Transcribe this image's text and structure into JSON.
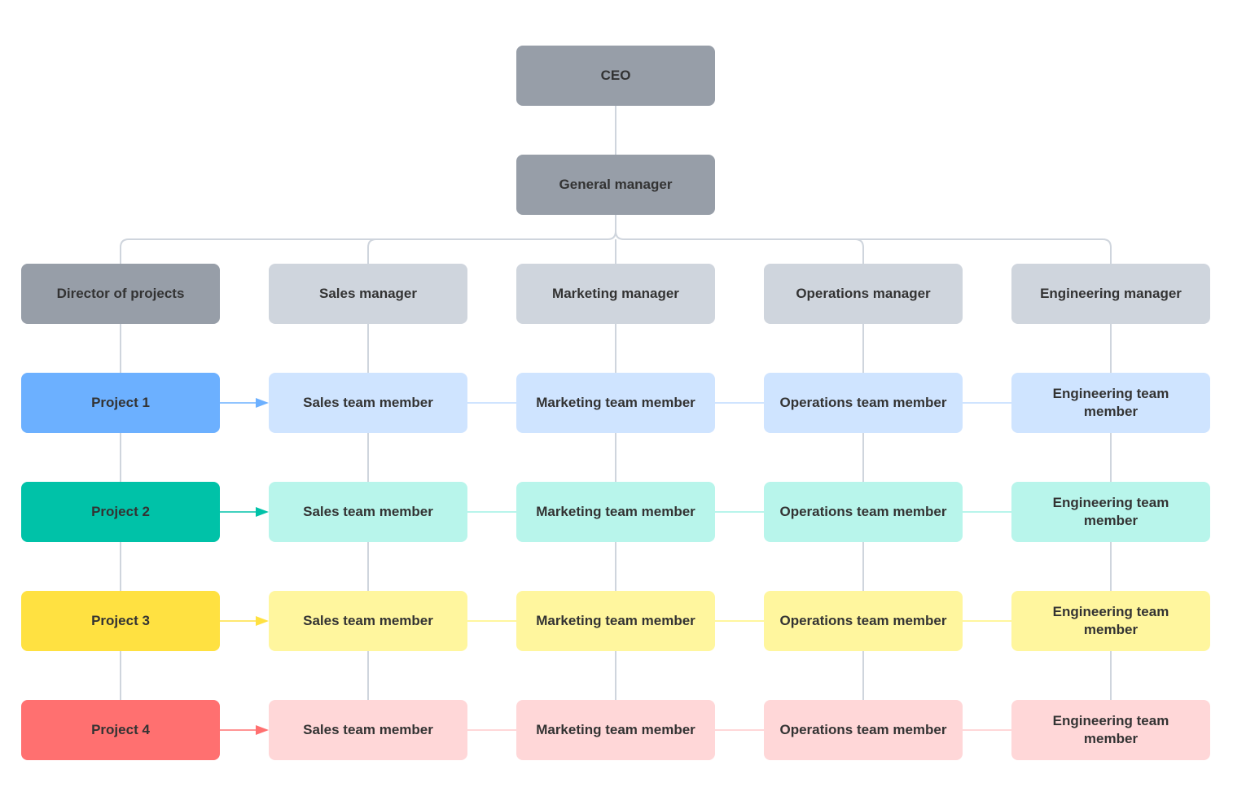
{
  "chart": {
    "ceo": {
      "label": "CEO",
      "color": "#979ea8"
    },
    "general_manager": {
      "label": "General manager",
      "color": "#979ea8"
    },
    "director": {
      "label": "Director of projects",
      "color": "#979ea8"
    },
    "managers": [
      {
        "label": "Sales manager",
        "color": "#cfd5dd"
      },
      {
        "label": "Marketing manager",
        "color": "#cfd5dd"
      },
      {
        "label": "Operations manager",
        "color": "#cfd5dd"
      },
      {
        "label": "Engineering manager",
        "color": "#cfd5dd"
      }
    ],
    "projects": [
      {
        "label": "Project 1",
        "color": "#6cb0ff",
        "light": "#cfe4ff",
        "line": "#6cb0ff",
        "members": [
          "Sales team member",
          "Marketing team member",
          "Operations team member",
          "Engineering team member"
        ]
      },
      {
        "label": "Project 2",
        "color": "#00c2a8",
        "light": "#b8f5eb",
        "line": "#00c2a8",
        "members": [
          "Sales team member",
          "Marketing team member",
          "Operations team member",
          "Engineering team member"
        ]
      },
      {
        "label": "Project 3",
        "color": "#ffe141",
        "light": "#fff69e",
        "line": "#ffe141",
        "members": [
          "Sales team member",
          "Marketing team member",
          "Operations team member",
          "Engineering team member"
        ]
      },
      {
        "label": "Project 4",
        "color": "#ff7070",
        "light": "#ffd7d8",
        "line": "#ff7070",
        "members": [
          "Sales team member",
          "Marketing team member",
          "Operations team member",
          "Engineering team member"
        ]
      }
    ],
    "connector_color": "#cfd5dd"
  }
}
